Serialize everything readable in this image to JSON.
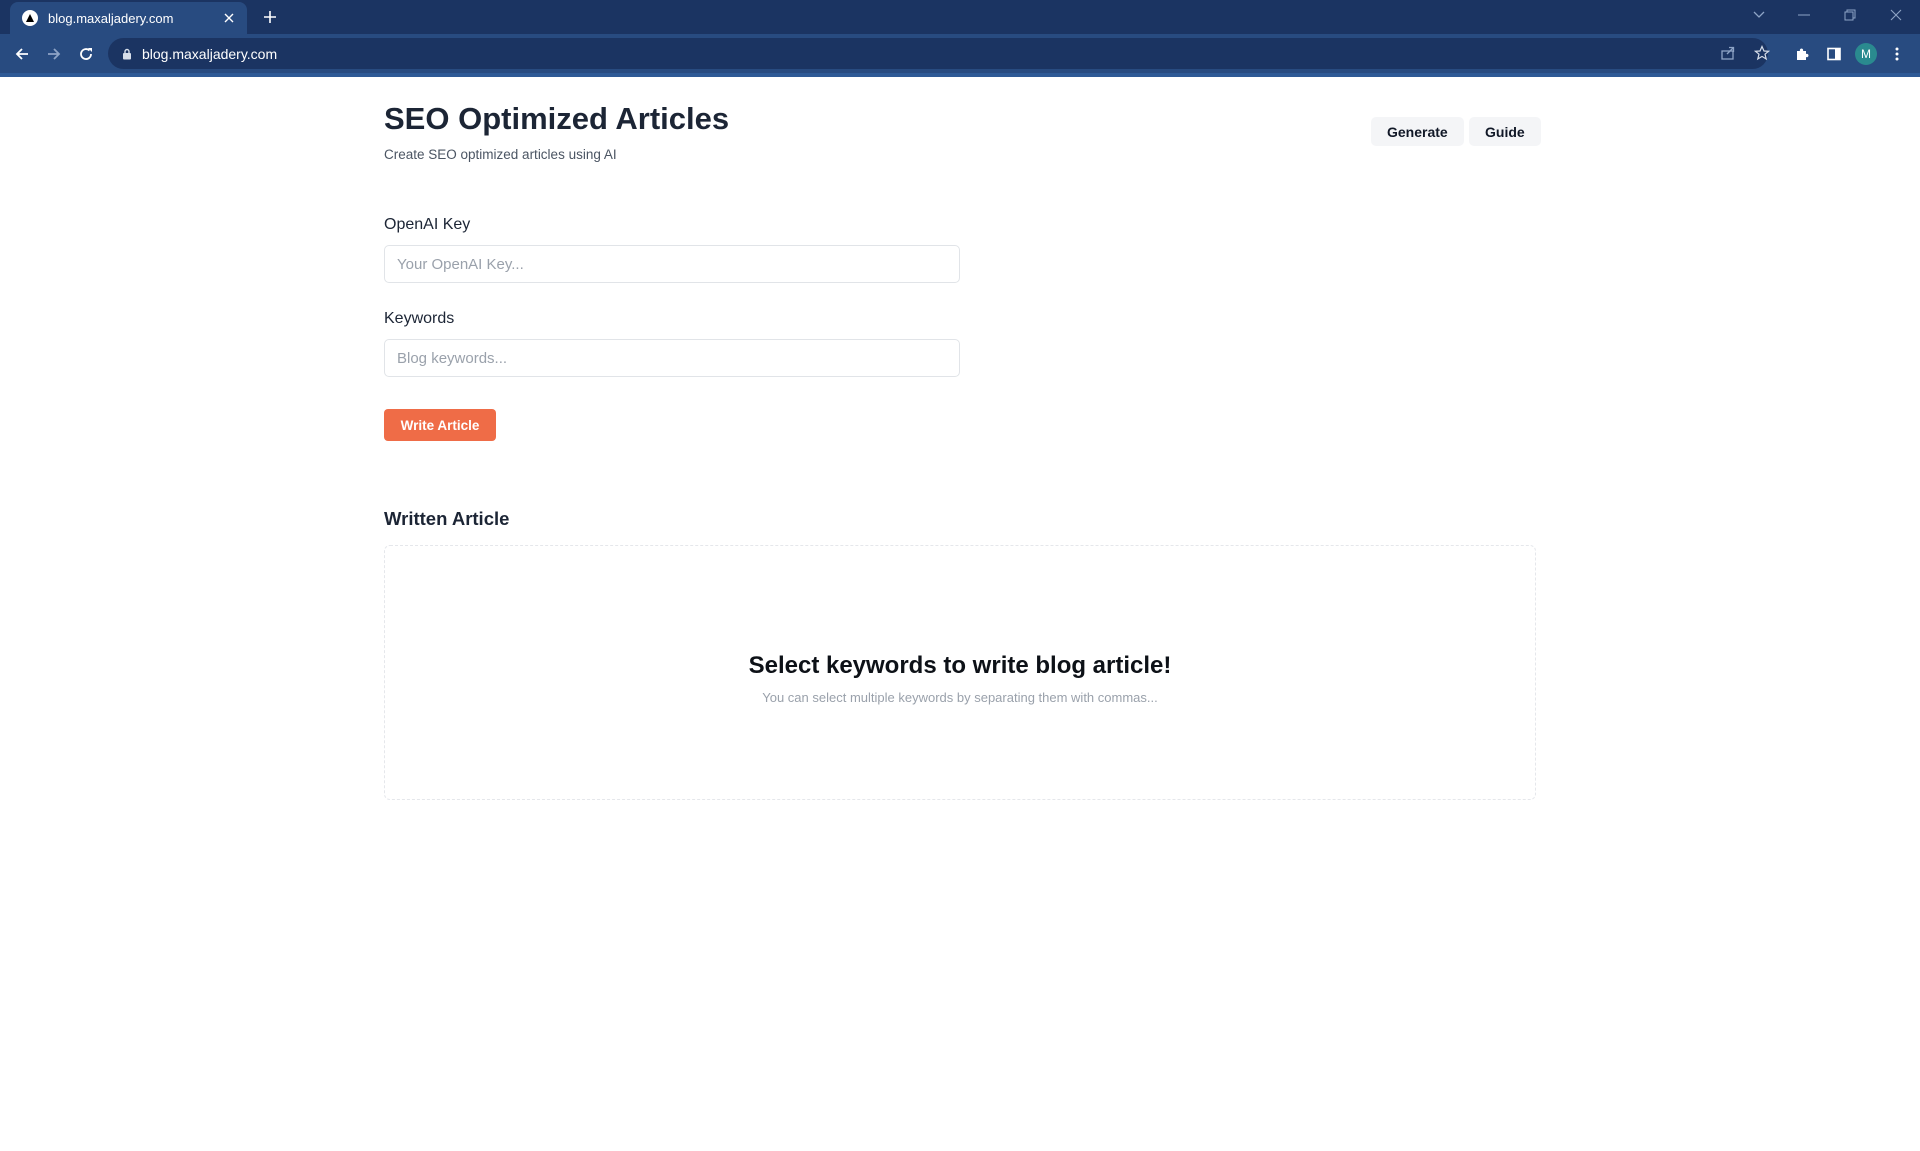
{
  "browser": {
    "tab_title": "blog.maxaljadery.com",
    "url": "blog.maxaljadery.com",
    "profile_initial": "M",
    "icons": [
      "vercel-favicon-icon",
      "close-icon",
      "plus-icon",
      "chevron-down-icon",
      "minimize-icon",
      "restore-icon",
      "close-window-icon",
      "back-arrow-icon",
      "forward-arrow-icon",
      "reload-icon",
      "lock-icon",
      "share-icon",
      "star-icon",
      "extensions-puzzle-icon",
      "side-panel-icon",
      "kebab-menu-icon"
    ]
  },
  "header": {
    "title": "SEO Optimized Articles",
    "subtitle": "Create SEO optimized articles using AI",
    "nav": [
      "Generate",
      "Guide"
    ]
  },
  "form": {
    "openai_label": "OpenAI Key",
    "openai_placeholder": "Your OpenAI Key...",
    "openai_value": "",
    "keywords_label": "Keywords",
    "keywords_placeholder": "Blog keywords...",
    "keywords_value": "",
    "submit_label": "Write Article"
  },
  "article": {
    "section_title": "Written Article",
    "empty_title": "Select keywords to write blog article!",
    "empty_subtitle": "You can select multiple keywords by separating them with commas..."
  },
  "colors": {
    "tabbar": "#1b3462",
    "toolbar": "#284b80",
    "accent_button": "#ef6c47",
    "avatar": "#2a8a8f"
  }
}
